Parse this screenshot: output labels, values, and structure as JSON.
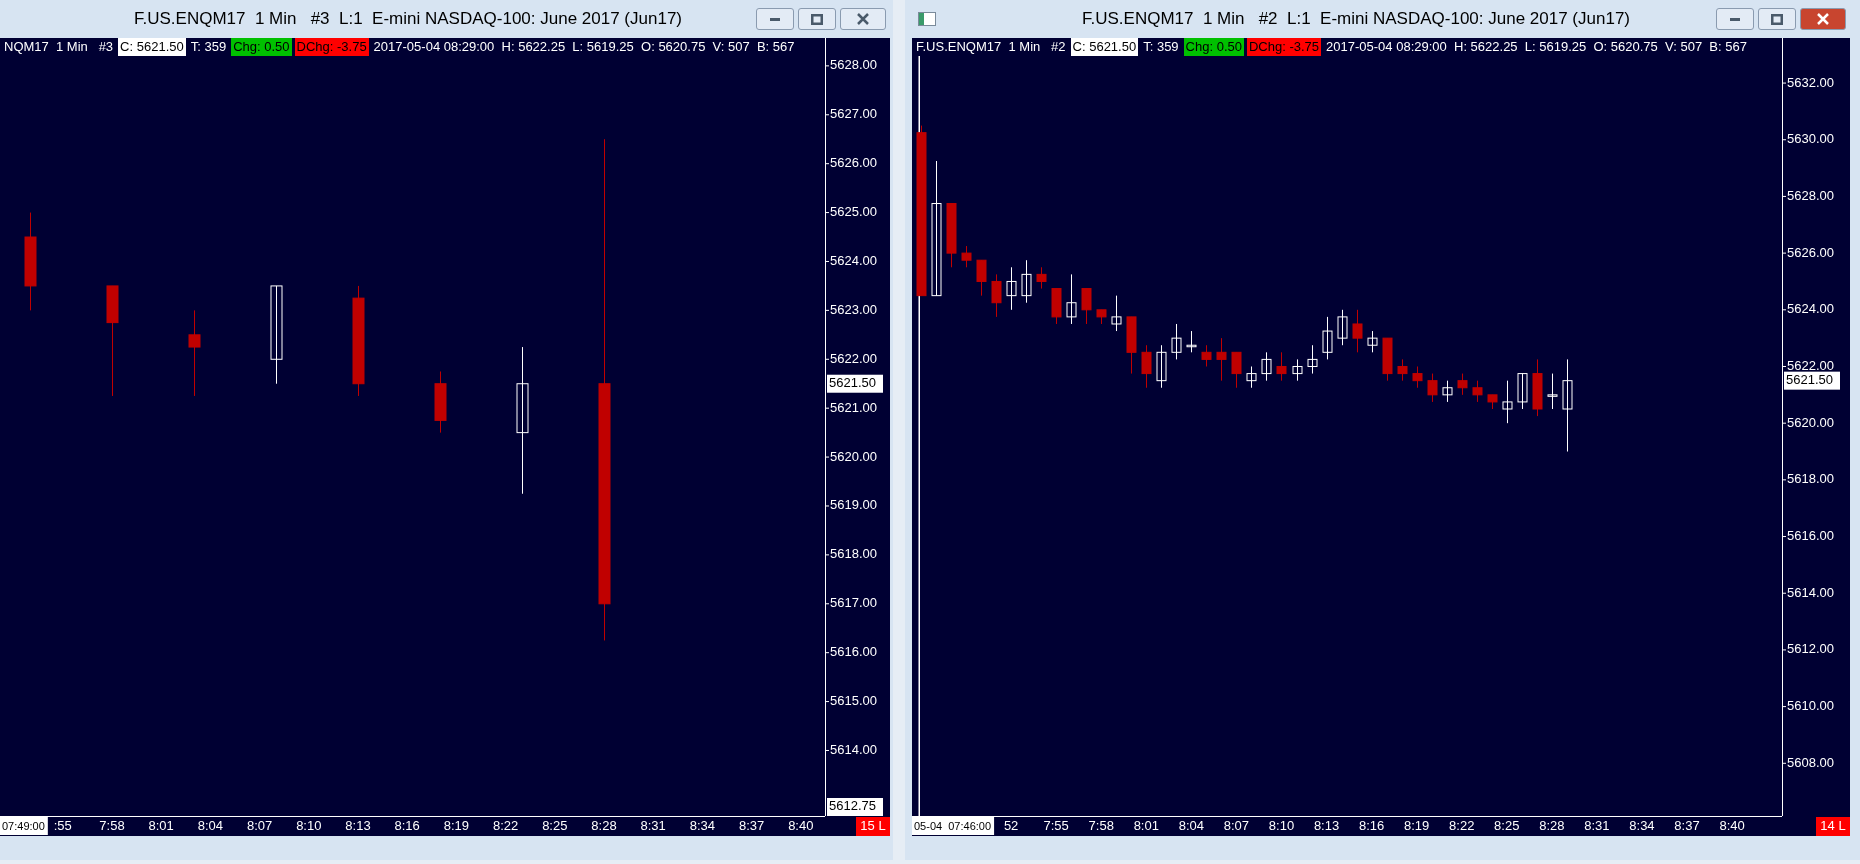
{
  "windows": [
    {
      "title": "F.US.ENQM17  1 Min   #3  L:1  E-mini NASDAQ-100: June 2017 (Jun17)",
      "active": false,
      "cursor_line": false,
      "cursor_label": "07:49:00",
      "bar_count": "15 L",
      "info_bar": [
        {
          "text": "NQM17  1 Min   #3"
        },
        {
          "text": "C: 5621.50",
          "color": "#ffffff"
        },
        {
          "text": "T: 359"
        },
        {
          "text": "Chg: 0.50",
          "color": "#00c000"
        },
        {
          "text": "DChg: -3.75",
          "color": "#ff0000"
        },
        {
          "text": "2017-05-04 08:29:00  H: 5622.25  L: 5619.25  O: 5620.75  V: 507  B: 567"
        }
      ],
      "chart_data": {
        "type": "candlestick",
        "categories": [
          null,
          null,
          null,
          ":55",
          null,
          null,
          "7:58",
          null,
          null,
          "8:01",
          null,
          null,
          "8:04",
          null,
          null,
          "8:07",
          null,
          null,
          "8:10",
          null,
          null,
          "8:13",
          null,
          null,
          "8:16",
          null,
          null,
          "8:19",
          null,
          null,
          "8:22",
          null,
          null,
          "8:25",
          null,
          null,
          "8:28",
          null,
          null,
          "8:31",
          null,
          null,
          "8:34",
          null,
          null,
          "8:37",
          null,
          null,
          "8:40",
          null
        ],
        "ohlc": [
          null,
          [
            5624.5,
            5625.0,
            5623.0,
            5623.5
          ],
          null,
          null,
          null,
          null,
          [
            5623.5,
            5623.5,
            5621.25,
            5622.75
          ],
          null,
          null,
          null,
          null,
          [
            5622.5,
            5623.0,
            5621.25,
            5622.25
          ],
          null,
          null,
          null,
          null,
          [
            5622.0,
            5623.5,
            5621.5,
            5623.5
          ],
          null,
          null,
          null,
          null,
          [
            5623.25,
            5623.5,
            5621.25,
            5621.5
          ],
          null,
          null,
          null,
          null,
          [
            5621.5,
            5621.75,
            5620.5,
            5620.75
          ],
          null,
          null,
          null,
          null,
          [
            5620.5,
            5622.25,
            5619.25,
            5621.5
          ],
          null,
          null,
          null,
          null,
          [
            5621.5,
            5626.5,
            5616.25,
            5617.0
          ],
          null,
          null,
          null,
          null,
          null,
          null,
          null,
          null,
          null,
          null,
          null,
          null,
          null
        ],
        "ylim": [
          5612.66,
          5628.57
        ],
        "yticks": [
          {
            "value": 5628,
            "label": "5628.00"
          },
          {
            "value": 5627,
            "label": "5627.00"
          },
          {
            "value": 5626,
            "label": "5626.00"
          },
          {
            "value": 5625,
            "label": "5625.00"
          },
          {
            "value": 5624,
            "label": "5624.00"
          },
          {
            "value": 5623,
            "label": "5623.00"
          },
          {
            "value": 5622,
            "label": "5622.00"
          },
          {
            "value": 5621,
            "label": "5621.00"
          },
          {
            "value": 5620,
            "label": "5620.00"
          },
          {
            "value": 5619,
            "label": "5619.00"
          },
          {
            "value": 5618,
            "label": "5618.00"
          },
          {
            "value": 5617,
            "label": "5617.00"
          },
          {
            "value": 5616,
            "label": "5616.00"
          },
          {
            "value": 5615,
            "label": "5615.00"
          },
          {
            "value": 5614,
            "label": "5614.00"
          }
        ],
        "annotations": [
          "5621.50",
          "5612.75"
        ]
      }
    },
    {
      "title": "F.US.ENQM17  1 Min   #2  L:1  E-mini NASDAQ-100: June 2017 (Jun17)",
      "active": true,
      "cursor_line": true,
      "cursor_label": "05-04  07:46:00",
      "bar_count": "14 L",
      "info_bar": [
        {
          "text": "F.US.ENQM17  1 Min   #2"
        },
        {
          "text": "C: 5621.50",
          "color": "#ffffff"
        },
        {
          "text": "T: 359"
        },
        {
          "text": "Chg: 0.50",
          "color": "#00c000"
        },
        {
          "text": "DChg: -3.75",
          "color": "#ff0000"
        },
        {
          "text": "2017-05-04 08:29:00  H: 5622.25  L: 5619.25  O: 5620.75  V: 507  B: 567"
        }
      ],
      "chart_data": {
        "type": "candlestick",
        "categories": [
          null,
          null,
          null,
          null,
          null,
          null,
          "52",
          null,
          null,
          "7:55",
          null,
          null,
          "7:58",
          null,
          null,
          "8:01",
          null,
          null,
          "8:04",
          null,
          null,
          "8:07",
          null,
          null,
          "8:10",
          null,
          null,
          "8:13",
          null,
          null,
          "8:16",
          null,
          null,
          "8:19",
          null,
          null,
          "8:22",
          null,
          null,
          "8:25",
          null,
          null,
          "8:28",
          null,
          null,
          "8:31",
          null,
          null,
          "8:34",
          null,
          null,
          "8:37",
          null,
          null,
          "8:40",
          null,
          null,
          null
        ],
        "ohlc": [
          [
            5630.25,
            5630.5,
            5624.5,
            5624.5
          ],
          [
            5624.5,
            5629.25,
            5624.5,
            5627.75
          ],
          [
            5627.75,
            5627.75,
            5625.5,
            5626.0
          ],
          [
            5626.0,
            5626.25,
            5625.5,
            5625.75
          ],
          [
            5625.75,
            5625.75,
            5624.5,
            5625.0
          ],
          [
            5625.0,
            5625.25,
            5623.75,
            5624.25
          ],
          [
            5624.5,
            5625.5,
            5624.0,
            5625.0
          ],
          [
            5624.5,
            5625.75,
            5624.25,
            5625.25
          ],
          [
            5625.25,
            5625.5,
            5624.75,
            5625.0
          ],
          [
            5624.75,
            5624.75,
            5623.5,
            5623.75
          ],
          [
            5623.75,
            5625.25,
            5623.5,
            5624.25
          ],
          [
            5624.75,
            5624.75,
            5623.5,
            5624.0
          ],
          [
            5624.0,
            5624.0,
            5623.5,
            5623.75
          ],
          [
            5623.5,
            5624.5,
            5623.25,
            5623.75
          ],
          [
            5623.75,
            5623.75,
            5621.75,
            5622.5
          ],
          [
            5622.5,
            5622.75,
            5621.25,
            5621.75
          ],
          [
            5621.5,
            5622.75,
            5621.25,
            5622.5
          ],
          [
            5622.5,
            5623.5,
            5622.25,
            5623.0
          ],
          [
            5622.75,
            5623.25,
            5622.5,
            5622.75
          ],
          [
            5622.5,
            5622.75,
            5622.0,
            5622.25
          ],
          [
            5622.5,
            5623.0,
            5621.5,
            5622.25
          ],
          [
            5622.5,
            5622.5,
            5621.25,
            5621.75
          ],
          [
            5621.5,
            5622.0,
            5621.25,
            5621.75
          ],
          [
            5621.75,
            5622.5,
            5621.5,
            5622.25
          ],
          [
            5622.0,
            5622.5,
            5621.5,
            5621.75
          ],
          [
            5621.75,
            5622.25,
            5621.5,
            5622.0
          ],
          [
            5622.0,
            5622.75,
            5621.75,
            5622.25
          ],
          [
            5622.5,
            5623.75,
            5622.25,
            5623.25
          ],
          [
            5623.0,
            5624.0,
            5622.75,
            5623.75
          ],
          [
            5623.5,
            5624.0,
            5622.5,
            5623.0
          ],
          [
            5622.75,
            5623.25,
            5622.5,
            5623.0
          ],
          [
            5623.0,
            5623.0,
            5621.5,
            5621.75
          ],
          [
            5622.0,
            5622.25,
            5621.5,
            5621.75
          ],
          [
            5621.75,
            5622.0,
            5621.25,
            5621.5
          ],
          [
            5621.5,
            5621.75,
            5620.75,
            5621.0
          ],
          [
            5621.0,
            5621.5,
            5620.75,
            5621.25
          ],
          [
            5621.5,
            5621.75,
            5621.0,
            5621.25
          ],
          [
            5621.25,
            5621.5,
            5620.75,
            5621.0
          ],
          [
            5621.0,
            5621.0,
            5620.5,
            5620.75
          ],
          [
            5620.5,
            5621.5,
            5620.0,
            5620.75
          ],
          [
            5620.75,
            5621.75,
            5620.5,
            5621.75
          ],
          [
            5621.75,
            5622.25,
            5620.25,
            5620.5
          ],
          [
            5621.0,
            5621.75,
            5620.5,
            5621.0
          ],
          [
            5620.5,
            5622.25,
            5619.0,
            5621.5
          ],
          null,
          null,
          null,
          null,
          null,
          null,
          null,
          null,
          null,
          null,
          null,
          null,
          null,
          null
        ],
        "ylim": [
          5606.14,
          5633.59
        ],
        "yticks": [
          {
            "value": 5632,
            "label": "5632.00"
          },
          {
            "value": 5630,
            "label": "5630.00"
          },
          {
            "value": 5628,
            "label": "5628.00"
          },
          {
            "value": 5626,
            "label": "5626.00"
          },
          {
            "value": 5624,
            "label": "5624.00"
          },
          {
            "value": 5622,
            "label": "5622.00"
          },
          {
            "value": 5620,
            "label": "5620.00"
          },
          {
            "value": 5618,
            "label": "5618.00"
          },
          {
            "value": 5616,
            "label": "5616.00"
          },
          {
            "value": 5614,
            "label": "5614.00"
          },
          {
            "value": 5612,
            "label": "5612.00"
          },
          {
            "value": 5610,
            "label": "5610.00"
          },
          {
            "value": 5608,
            "label": "5608.00"
          }
        ],
        "annotations": [
          "5621.50"
        ]
      }
    }
  ]
}
